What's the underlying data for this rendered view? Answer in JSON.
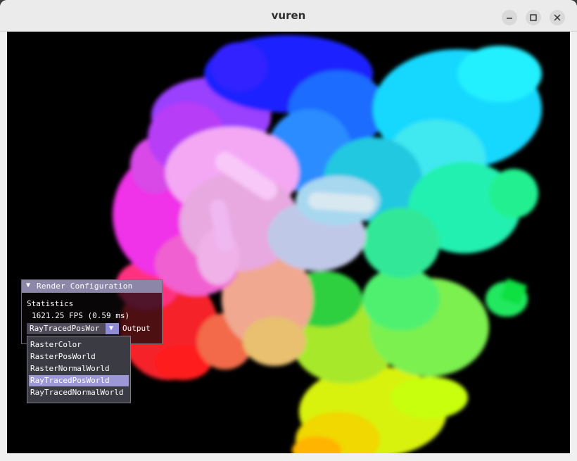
{
  "window": {
    "title": "vuren",
    "controls": [
      "minimize-icon",
      "maximize-icon",
      "close-icon"
    ]
  },
  "panel": {
    "title": "Render Configuration",
    "collapse_icon": "triangle-down-icon",
    "statistics_label": "Statistics",
    "fps_text": "1621.25 FPS (0.59 ms)",
    "combo_value": "RayTracedPosWor",
    "combo_label": "Output"
  },
  "dropdown": {
    "options": [
      "RasterColor",
      "RasterPosWorld",
      "RasterNormalWorld",
      "RayTracedPosWorld",
      "RayTracedNormalWorld"
    ],
    "selected": "RayTracedPosWorld"
  },
  "colors": {
    "viewport_bg": "#000000",
    "header_bg": "#8c86a8",
    "selected_option": "#9c98d8"
  }
}
